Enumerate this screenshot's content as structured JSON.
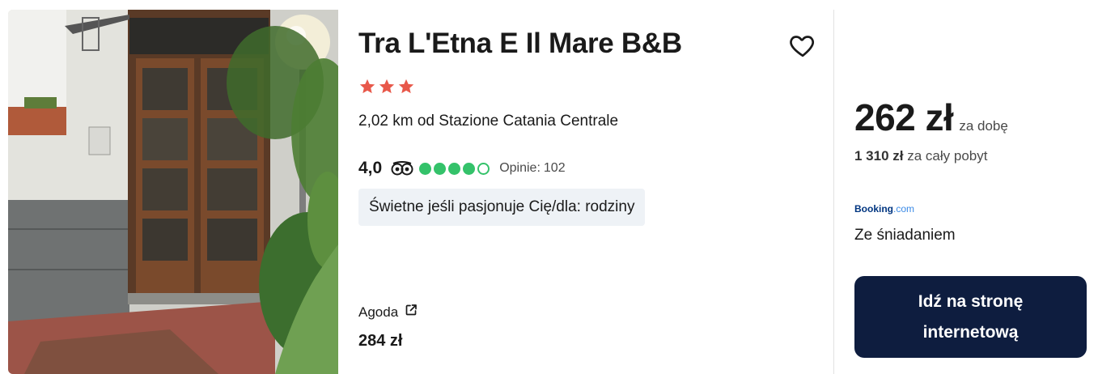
{
  "hotel": {
    "name": "Tra L'Etna E Il Mare B&B",
    "star_count": 3,
    "star_color": "#e8584a",
    "distance": "2,02 km od Stazione Catania Centrale",
    "rating": {
      "score": "4,0",
      "bubbles": 4,
      "bubbles_max": 5,
      "bubble_color": "#34c26a",
      "reviews_label": "Opinie:",
      "reviews_count": "102"
    },
    "tag": "Świetne jeśli pasjonuje Cię/dla: rodziny",
    "image_icon": "hotel-entrance-photo"
  },
  "alternative_offer": {
    "provider": "Agoda",
    "provider_icon": "external-link-icon",
    "price": "284 zł"
  },
  "main_offer": {
    "price": "262 zł",
    "price_unit": "za dobę",
    "total_amount": "1 310 zł",
    "total_label": "za cały pobyt",
    "provider_logo_part1": "Booking",
    "provider_logo_part2": ".com",
    "amenity": "Ze śniadaniem",
    "cta_label": "Idź na stronę internetową",
    "cta_color": "#0e1d3f"
  },
  "icons": {
    "favorite": "heart-outline-icon",
    "tripadvisor": "tripadvisor-owl-icon"
  }
}
